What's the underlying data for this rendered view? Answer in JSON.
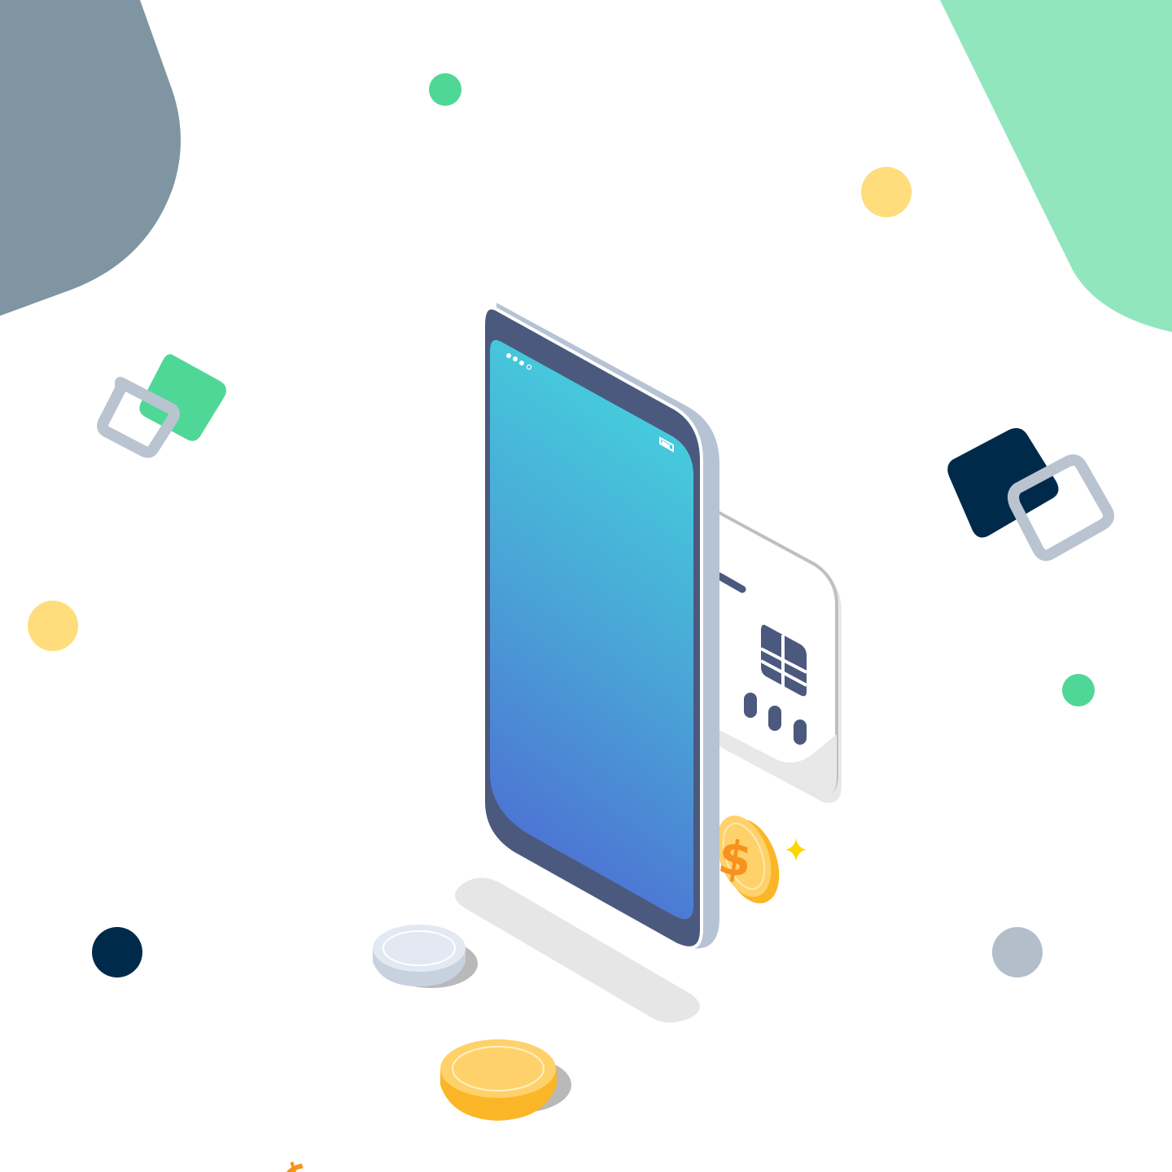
{
  "illustration": {
    "subject": "mobile-payment-isometric",
    "palette": {
      "background": "#ffffff",
      "blob_slate": "#7f95a1",
      "blob_mint": "#92e6bd",
      "green": "#4fd797",
      "yellow": "#ffdd7c",
      "navy": "#002a4a",
      "gray": "#b2bfcb",
      "phone_frame": "#4c597e",
      "phone_edge": "#b6c3d5",
      "screen_top": "#44d3dd",
      "screen_bottom": "#4d6bd3",
      "card_body": "#ffffff",
      "card_shadow": "#e8e8e8",
      "coin_gold": "#ffd16a",
      "coin_gold_edge": "#fbb627",
      "coin_symbol": "#f7921e",
      "coin_silver": "#e3e9f2",
      "coin_silver_edge": "#c8d2df",
      "floor_shadow": "#e6e6e6"
    },
    "icons": {
      "status_dots": "signal-dots-icon",
      "battery": "battery-icon",
      "card_chip": "card-chip-icon",
      "sparkle": "sparkle-icon",
      "coin_symbol": "dollar-sign-icon"
    },
    "coin_symbol_text": "$"
  }
}
